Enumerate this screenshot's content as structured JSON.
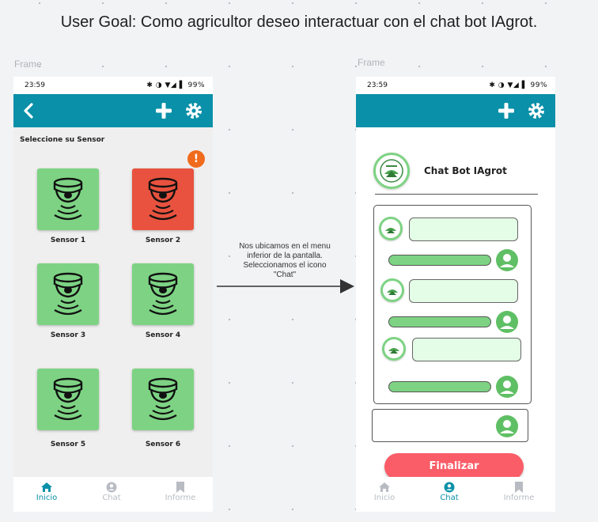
{
  "user_goal": "User Goal: Como agricultor deseo interactuar con el chat bot IAgrot.",
  "frame_label": "Frame",
  "colors": {
    "primary": "#0a90a8",
    "sensor_ok": "#7dd383",
    "sensor_alert": "#e8523e",
    "alert_badge": "#f06b1c",
    "finalize_button": "#fa5d68",
    "bot_bubble": "#e4fde6"
  },
  "status_bar": {
    "time": "23:59",
    "icons": "✱ ◑ ▼◢ ▌ 99%",
    "battery": "99%"
  },
  "screen_sensors": {
    "top_bar_icons": [
      "back-arrow-icon",
      "plus-icon",
      "gear-icon"
    ],
    "title": "Seleccione su Sensor",
    "alert_badge": "!",
    "sensors": [
      {
        "label": "Sensor 1",
        "status": "ok"
      },
      {
        "label": "Sensor 2",
        "status": "alert"
      },
      {
        "label": "Sensor 3",
        "status": "ok"
      },
      {
        "label": "Sensor 4",
        "status": "ok"
      },
      {
        "label": "Sensor 5",
        "status": "ok"
      },
      {
        "label": "Sensor 6",
        "status": "ok"
      }
    ],
    "nav": [
      {
        "label": "Inicio",
        "icon": "home-icon",
        "active": true
      },
      {
        "label": "Chat",
        "icon": "chat-user-icon",
        "active": false
      },
      {
        "label": "Informe",
        "icon": "bookmark-icon",
        "active": false
      }
    ]
  },
  "annotation": "Nos ubicamos en el menu inferior de la pantalla. Seleccionamos el icono \"Chat\"",
  "screen_chat": {
    "top_bar_icons": [
      "plus-icon",
      "gear-icon"
    ],
    "bot_name": "Chat Bot IAgrot",
    "finalize_label": "Finalizar",
    "nav": [
      {
        "label": "Inicio",
        "icon": "home-icon",
        "active": false
      },
      {
        "label": "Chat",
        "icon": "chat-user-icon",
        "active": true
      },
      {
        "label": "Informe",
        "icon": "bookmark-icon",
        "active": false
      }
    ]
  }
}
